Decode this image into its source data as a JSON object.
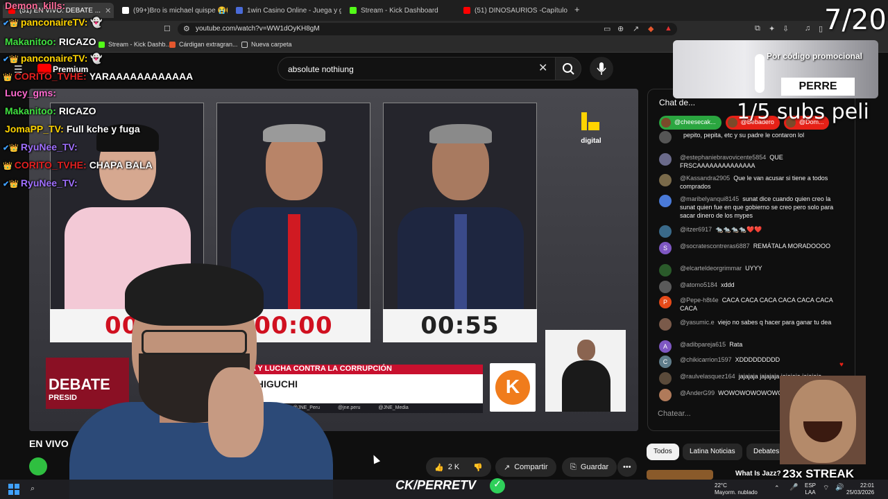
{
  "browser": {
    "tabs": [
      {
        "label": "(51) EN VIVO: DEBATE ...",
        "color": "#ff0000",
        "active": true
      },
      {
        "label": "(99+)Bro is michael quispe 😭😭 #C...",
        "color": "#ffffff",
        "active": false
      },
      {
        "label": "1win Casino Online - Juega y gana h...",
        "color": "#4a6bd8",
        "active": false
      },
      {
        "label": "Stream - Kick Dashboard",
        "color": "#53fc18",
        "active": false
      },
      {
        "label": "(51) DINOSAURIOS -Capítulo Final- P...",
        "color": "#ff0000",
        "active": false
      }
    ],
    "url": "youtube.com/watch?v=WW1dOyKH8gM",
    "bookmarks": [
      {
        "label": "Stream - Kick Dashb...",
        "color": "#53fc18"
      },
      {
        "label": "Cárdigan extragran...",
        "color": "#e4572e"
      },
      {
        "label": "Nueva carpeta",
        "color": "#cccccc"
      }
    ]
  },
  "youtube": {
    "premium_label": "Premium",
    "search_value": "absolute nothiung",
    "live_label": "EN VIVO",
    "like_count": "2 K",
    "share_label": "Compartir",
    "save_label": "Guardar",
    "filters": [
      "Todos",
      "Latina Noticias",
      "Debates"
    ],
    "recommendation_title": "What Is Jazz?"
  },
  "video": {
    "timers": [
      "00:",
      "00:00",
      "00:55"
    ],
    "lower_third_topic": "ICA Y LUCHA CONTRA LA CORRUPCIÓN",
    "lower_third_name": "RI HIGUCHI",
    "lower_third_sub": "AR",
    "social_handles": [
      "@JNE_Peru",
      "@jne.peru",
      "@JNE_Media"
    ],
    "debate_label": "DEBATE",
    "debate_sub": "PRESID",
    "brand_logo_text": "digital",
    "k_logo_text": "K"
  },
  "chat_panel": {
    "title": "Chat de...",
    "donors": [
      {
        "name": "@cheesecak...",
        "color": "#2ba640"
      },
      {
        "name": "@Bebadero",
        "color": "#e62117"
      },
      {
        "name": "@Dom...",
        "color": "#e62117"
      }
    ],
    "messages": [
      {
        "author": "",
        "text": "pepito, pepita, etc y su padre le contaron lol",
        "initial": "",
        "color": "#555555"
      },
      {
        "author": "@estephaniebravovicente5854",
        "text": "QUE FRSCAAAAAAAAAAAAAA",
        "initial": "",
        "color": "#6a6a8a"
      },
      {
        "author": "@Kassandra2905",
        "text": "Que le van acusar si tiene a todos comprados",
        "initial": "",
        "color": "#7a6a4a"
      },
      {
        "author": "@maribelyanqui8145",
        "text": "sunat dice cuando quien creo la sunat quien fue en que gobierno se creo pero solo para sacar dinero de los mypes",
        "initial": "",
        "color": "#4a7ad8"
      },
      {
        "author": "@itzer6917",
        "text": "🐀🐀🐀🐀❤️❤️",
        "initial": "",
        "color": "#3a6a8a"
      },
      {
        "author": "@socratescontreras6887",
        "text": "REMÁTALA MORADOOOO",
        "initial": "S",
        "color": "#7e57c2"
      },
      {
        "author": "@elcarteldeorgrimmar",
        "text": "UYYY",
        "initial": "",
        "color": "#2a5a2a"
      },
      {
        "author": "@atomo5184",
        "text": "xddd",
        "initial": "",
        "color": "#5a5a5a"
      },
      {
        "author": "@Pepe-h8t4e",
        "text": "CACA CACA CACA CACA CACA CACA CACA",
        "initial": "P",
        "color": "#e64a19"
      },
      {
        "author": "@yasumic.e",
        "text": "viejo no sabes q hacer para ganar tu dea",
        "initial": "",
        "color": "#7a5a4a"
      },
      {
        "author": "@adibpareja615",
        "text": "Rata",
        "initial": "A",
        "color": "#7e57c2"
      },
      {
        "author": "@chikicarrion1597",
        "text": "XDDDDDDDDD",
        "initial": "C",
        "color": "#607d8b"
      },
      {
        "author": "@raulvelasquez164",
        "text": "jajajaja jajajaja jajajaja jajajaja",
        "initial": "",
        "color": "#5a4a3a"
      },
      {
        "author": "@AnderG99",
        "text": "WOWOWOWOWOWO",
        "initial": "",
        "color": "#b07a5a"
      }
    ],
    "input_placeholder": "Chatear..."
  },
  "overlay_chat": [
    {
      "user": "Demon_kills:",
      "text": "",
      "color": "#ff6b9a",
      "icons": ""
    },
    {
      "user": "panconaireTV:",
      "text": "👻",
      "color": "#ffd400",
      "icons": "✔👑"
    },
    {
      "user": "Makanitoo:",
      "text": "RICAZO",
      "color": "#40e040",
      "icons": ""
    },
    {
      "user": "panconaireTV:",
      "text": "👻",
      "color": "#ffd400",
      "icons": "✔👑"
    },
    {
      "user": "CORITO_TVHE:",
      "text": "YARAAAAAAAAAAAA",
      "color": "#e02020",
      "icons": "👑"
    },
    {
      "user": "Lucy_gms:",
      "text": "",
      "color": "#ff6bd0",
      "icons": ""
    },
    {
      "user": "Makanitoo:",
      "text": "RICAZO",
      "color": "#40e040",
      "icons": ""
    },
    {
      "user": "JomaPP_TV:",
      "text": "Full kche y fuga",
      "color": "#ffd400",
      "icons": ""
    },
    {
      "user": "RyuNee_TV:",
      "text": "",
      "color": "#a070ff",
      "icons": "✔👑"
    },
    {
      "user": "CORITO_TVHE:",
      "text": "CHAPA BALA",
      "color": "#e02020",
      "icons": "👑"
    },
    {
      "user": "RyuNee_TV:",
      "text": "",
      "color": "#a070ff",
      "icons": "✔👑"
    }
  ],
  "stream_overlay": {
    "counter": "7/20",
    "promo_title": "Por código promocional",
    "promo_code": "PERRE",
    "subs_text": "1/5 subs peli",
    "streak_text": "23x STREAK",
    "channel_tag": "CK/PERRETV"
  },
  "taskbar": {
    "weather_temp": "22°C",
    "weather_desc": "Mayorm. nublado",
    "lang_top": "ESP",
    "lang_bottom": "LAA",
    "time": "22:01",
    "date": "25/03/2026"
  }
}
